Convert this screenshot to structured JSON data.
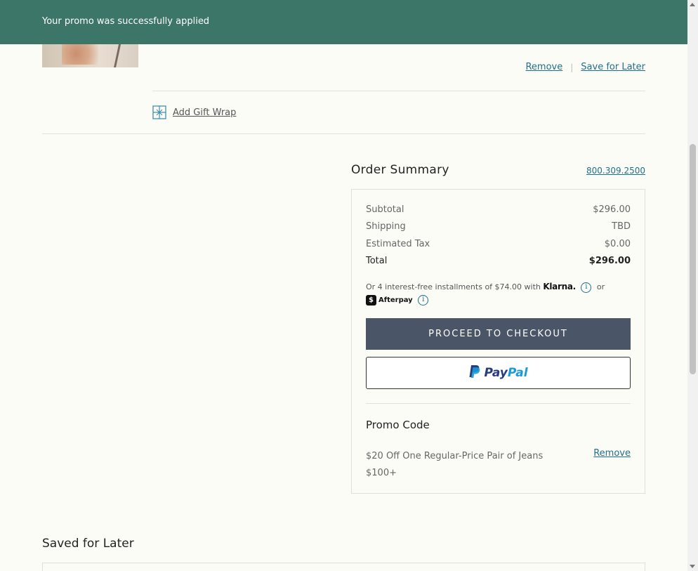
{
  "banner": {
    "message": "Your promo was successfully applied"
  },
  "cart_item": {
    "remove_label": "Remove",
    "save_for_later_label": "Save for Later",
    "separator": "|",
    "gift_wrap_label": "Add Gift Wrap"
  },
  "order_summary": {
    "heading": "Order Summary",
    "phone": "800.309.2500",
    "subtotal_label": "Subtotal",
    "subtotal_value": "$296.00",
    "shipping_label": "Shipping",
    "shipping_value": "TBD",
    "tax_label": "Estimated Tax",
    "tax_value": "$0.00",
    "total_label": "Total",
    "total_value": "$296.00",
    "installments_text": "Or 4 interest-free installments of $74.00 with",
    "klarna": "Klarna.",
    "or_text": "or",
    "afterpay": "Afterpay",
    "checkout_label": "PROCEED TO CHECKOUT",
    "paypal_pay": "Pay",
    "paypal_pal": "Pal"
  },
  "promo": {
    "heading": "Promo Code",
    "description": "$20 Off One Regular-Price Pair of Jeans $100+",
    "remove_label": "Remove"
  },
  "saved_for_later": {
    "heading": "Saved for Later"
  },
  "colors": {
    "banner_bg": "#3b7669",
    "checkout_bg": "#4a5567",
    "link": "#1f6f8b",
    "page_bg": "#fcfcf7"
  },
  "icons": [
    "gift-icon",
    "info-icon",
    "afterpay-icon",
    "paypal-logo-icon"
  ]
}
